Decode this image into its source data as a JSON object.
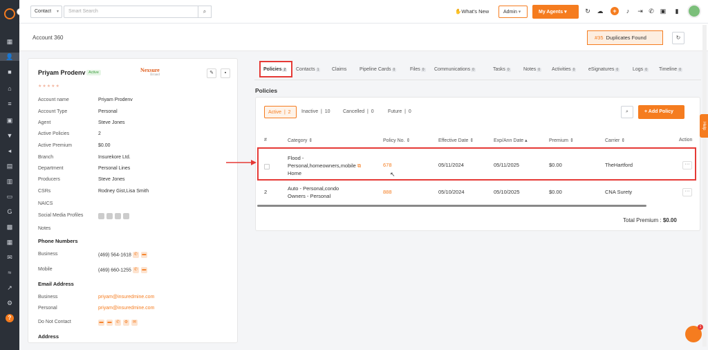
{
  "topbar": {
    "search_scope": "Contact",
    "search_placeholder": "Smart Search",
    "whats_new": "What's New",
    "role": "Admin",
    "my_agents": "My Agents"
  },
  "subbar": {
    "title": "Account 360",
    "duplicates_count": "#35",
    "duplicates_label": "Duplicates Found"
  },
  "contact": {
    "name": "Priyam Prodenv",
    "status": "Active",
    "brand": "Nexsure",
    "brand_sub": "Errand",
    "fields": [
      {
        "label": "Account name",
        "value": "Priyam Prodenv"
      },
      {
        "label": "Account Type",
        "value": "Personal"
      },
      {
        "label": "Agent",
        "value": "Steve Jones"
      },
      {
        "label": "Active Policies",
        "value": "2"
      },
      {
        "label": "Active Premium",
        "value": "$0.00"
      },
      {
        "label": "Branch",
        "value": "Insurekore Ltd."
      },
      {
        "label": "Department",
        "value": "Personal Lines"
      },
      {
        "label": "Producers",
        "value": "Steve Jones"
      },
      {
        "label": "CSRs",
        "value": "Rodney Gist,Lisa Smith"
      },
      {
        "label": "NAICS",
        "value": ""
      },
      {
        "label": "Social Media Profiles",
        "value": ""
      },
      {
        "label": "Notes",
        "value": ""
      }
    ],
    "phone_section": "Phone Numbers",
    "phones": [
      {
        "label": "Business",
        "value": "(469) 564-1618"
      },
      {
        "label": "Mobile",
        "value": "(469) 660-1255"
      }
    ],
    "email_section": "Email Address",
    "emails": [
      {
        "label": "Business",
        "value": "priyam@insuredmine.com"
      },
      {
        "label": "Personal",
        "value": "priyam@insuredmine.com"
      }
    ],
    "do_not_contact": "Do Not Contact",
    "address_section": "Address"
  },
  "tabs": [
    {
      "label": "Policies",
      "count": "2"
    },
    {
      "label": "Contacts",
      "count": "1"
    },
    {
      "label": "Claims",
      "count": ""
    },
    {
      "label": "Pipeline Cards",
      "count": "0"
    },
    {
      "label": "Files",
      "count": "0"
    },
    {
      "label": "Communications",
      "count": "0"
    },
    {
      "label": "Tasks",
      "count": "0"
    },
    {
      "label": "Notes",
      "count": "0"
    },
    {
      "label": "Activities",
      "count": "0"
    },
    {
      "label": "eSignatures",
      "count": "0"
    },
    {
      "label": "Logs",
      "count": "0"
    },
    {
      "label": "Timeline",
      "count": "0"
    }
  ],
  "policies": {
    "title": "Policies",
    "filters": [
      {
        "label": "Active",
        "count": "2"
      },
      {
        "label": "Inactive",
        "count": "10"
      },
      {
        "label": "Cancelled",
        "count": "0"
      },
      {
        "label": "Future",
        "count": "0"
      }
    ],
    "add_label": "+ Add Policy",
    "columns": [
      "#",
      "Category",
      "Policy No.",
      "Effective Date",
      "Exp/Ann Date",
      "Premium",
      "Carrier",
      "Action"
    ],
    "rows": [
      {
        "num": "",
        "category_l1": "Flood -",
        "category_l2": "Personal,homeowners,mobile",
        "category_l3": "Home",
        "policy_no": "678",
        "effective": "05/11/2024",
        "exp": "05/11/2025",
        "premium": "$0.00",
        "carrier": "TheHartford"
      },
      {
        "num": "2",
        "category_l1": "Auto - Personal,condo",
        "category_l2": "Owners - Personal",
        "category_l3": "",
        "policy_no": "888",
        "effective": "05/10/2024",
        "exp": "05/10/2025",
        "premium": "$0.00",
        "carrier": "CNA Surety"
      }
    ],
    "total_label": "Total Premium :",
    "total_value": "$0.00"
  },
  "help_tab": "Help",
  "colors": {
    "accent": "#f57c1f",
    "highlight": "#e53935",
    "sidebar": "#2b3038"
  }
}
